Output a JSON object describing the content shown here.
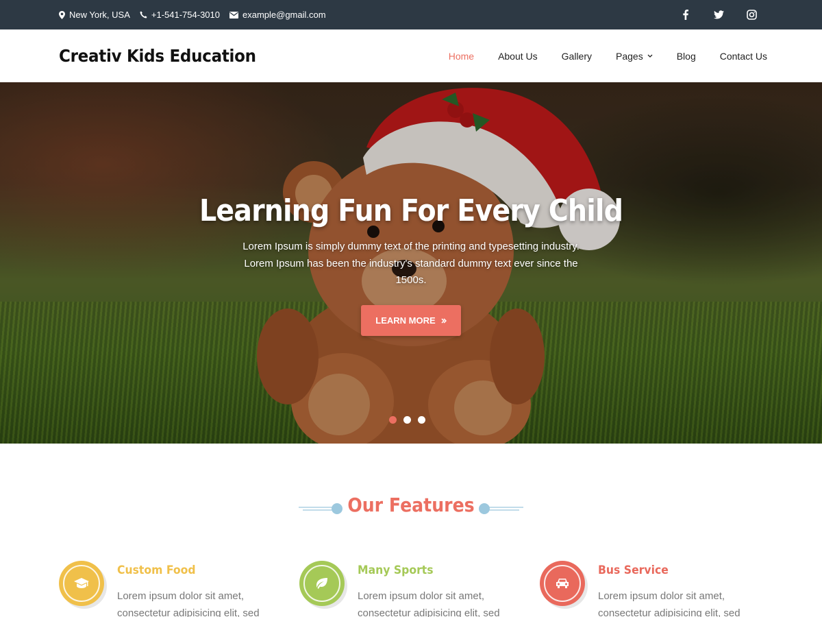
{
  "topbar": {
    "location": "New York, USA",
    "phone": "+1-541-754-3010",
    "email": "example@gmail.com",
    "social": [
      "facebook-icon",
      "twitter-icon",
      "instagram-icon"
    ]
  },
  "header": {
    "brand": "Creativ Kids Education",
    "nav": [
      {
        "label": "Home",
        "active": true
      },
      {
        "label": "About Us"
      },
      {
        "label": "Gallery"
      },
      {
        "label": "Pages",
        "dropdown": true
      },
      {
        "label": "Blog"
      },
      {
        "label": "Contact Us"
      }
    ]
  },
  "hero": {
    "title": "Learning Fun For Every Child",
    "text": "Lorem Ipsum is simply dummy text of the printing and typesetting industry. Lorem Ipsum has been the industry's standard dummy text ever since the 1500s.",
    "button": "LEARN MORE",
    "slides": 3,
    "active_slide": 1
  },
  "features": {
    "title": "Our Features",
    "items": [
      {
        "title": "Custom Food",
        "text": "Lorem ipsum dolor sit amet, consectetur adipisicing elit, sed",
        "color": "#f0c04a",
        "icon": "graduation-cap-icon"
      },
      {
        "title": "Many Sports",
        "text": "Lorem ipsum dolor sit amet, consectetur adipisicing elit, sed",
        "color": "#a5c957",
        "icon": "leaf-icon"
      },
      {
        "title": "Bus Service",
        "text": "Lorem ipsum dolor sit amet, consectetur adipisicing elit, sed",
        "color": "#e9695c",
        "icon": "car-icon"
      }
    ]
  },
  "colors": {
    "accent": "#ec6f61",
    "topbar": "#2d3944",
    "deco": "#9cc8de"
  }
}
